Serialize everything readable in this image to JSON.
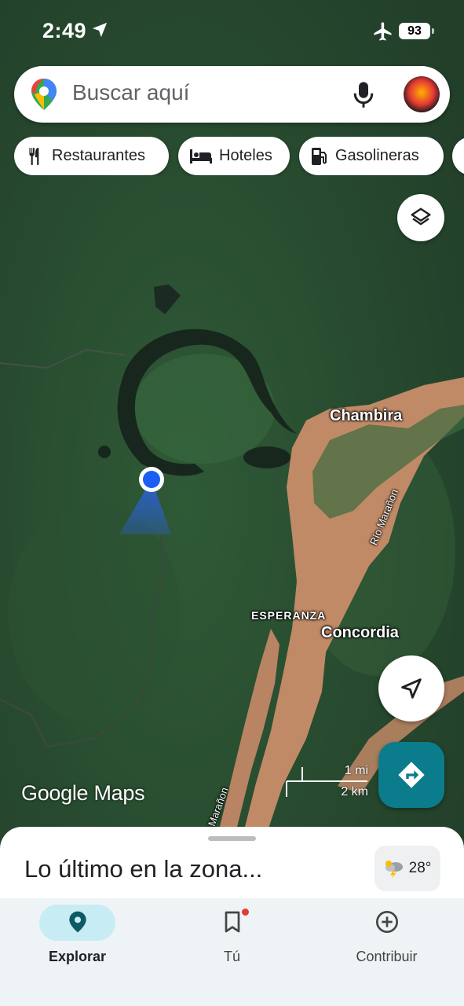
{
  "status_bar": {
    "time": "2:49",
    "battery": "93",
    "airplane_mode": true
  },
  "search": {
    "placeholder": "Buscar aquí"
  },
  "chips": [
    {
      "label": "Restaurantes",
      "icon": "fork-knife-icon"
    },
    {
      "label": "Hoteles",
      "icon": "bed-icon"
    },
    {
      "label": "Gasolineras",
      "icon": "gas-pump-icon"
    }
  ],
  "map": {
    "labels": {
      "chambira": "Chambira",
      "esperanza": "ESPERANZA",
      "concordia": "Concordia",
      "rio_maranon": "Río Marañon",
      "maranon": "Marañon"
    },
    "scale": {
      "mi": "1 mi",
      "km": "2 km"
    },
    "logo": "Google Maps"
  },
  "sheet": {
    "title": "Lo último en la zona...",
    "weather_temp": "28°"
  },
  "bottom_nav": {
    "items": [
      {
        "label": "Explorar",
        "active": true
      },
      {
        "label": "Tú",
        "active": false
      },
      {
        "label": "Contribuir",
        "active": false
      }
    ]
  },
  "colors": {
    "accent": "#0b7c8c",
    "location_dot": "#1a5ff2",
    "river": "#c48f6c",
    "forest": "#2f5532"
  }
}
